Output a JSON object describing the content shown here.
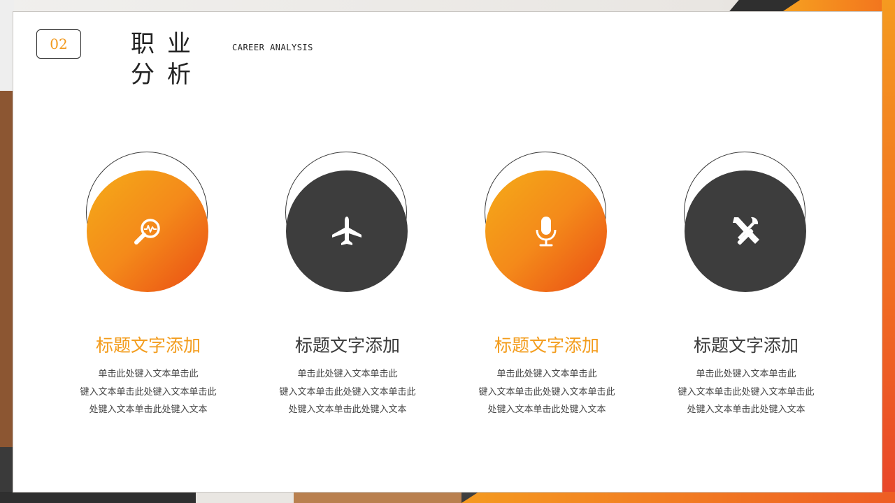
{
  "header": {
    "number": "02",
    "title": "职业分析",
    "subtitle": "CAREER ANALYSIS"
  },
  "colors": {
    "accent": "#f39c1c",
    "accent_end": "#ea4c14",
    "dark": "#3d3d3d"
  },
  "items": [
    {
      "icon": "search-pulse-icon",
      "title": "标题文字添加",
      "lines": [
        "单击此处键入文本单击此",
        "键入文本单击此处键入文本单击此",
        "处键入文本单击此处键入文本"
      ]
    },
    {
      "icon": "airplane-icon",
      "title": "标题文字添加",
      "lines": [
        "单击此处键入文本单击此",
        "键入文本单击此处键入文本单击此",
        "处键入文本单击此处键入文本"
      ]
    },
    {
      "icon": "microphone-icon",
      "title": "标题文字添加",
      "lines": [
        "单击此处键入文本单击此",
        "键入文本单击此处键入文本单击此",
        "处键入文本单击此处键入文本"
      ]
    },
    {
      "icon": "tools-icon",
      "title": "标题文字添加",
      "lines": [
        "单击此处键入文本单击此",
        "键入文本单击此处键入文本单击此",
        "处键入文本单击此处键入文本"
      ]
    }
  ]
}
